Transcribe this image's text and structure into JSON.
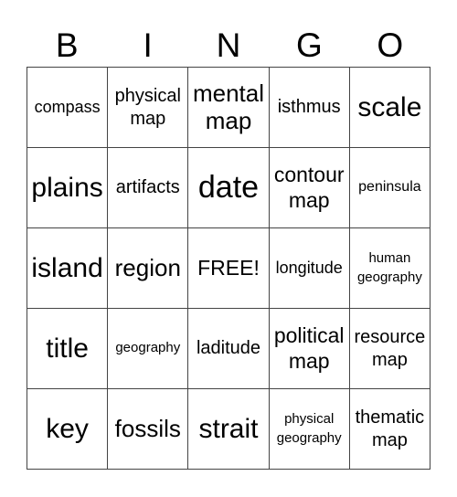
{
  "title_letters": [
    "B",
    "I",
    "N",
    "G",
    "O"
  ],
  "cells": [
    [
      "compass",
      "physical map",
      "mental map",
      "isthmus",
      "scale"
    ],
    [
      "plains",
      "artifacts",
      "date",
      "contour map",
      "peninsula"
    ],
    [
      "island",
      "region",
      "FREE!",
      "longitude",
      "human geography"
    ],
    [
      "title",
      "geography",
      "laditude",
      "political map",
      "resource map"
    ],
    [
      "key",
      "fossils",
      "strait",
      "physical geography",
      "thematic map"
    ]
  ],
  "free_space": {
    "row": 2,
    "col": 2,
    "label": "FREE!"
  },
  "colors": {
    "text": "#000000",
    "grid_line": "#444444",
    "background": "#ffffff"
  }
}
